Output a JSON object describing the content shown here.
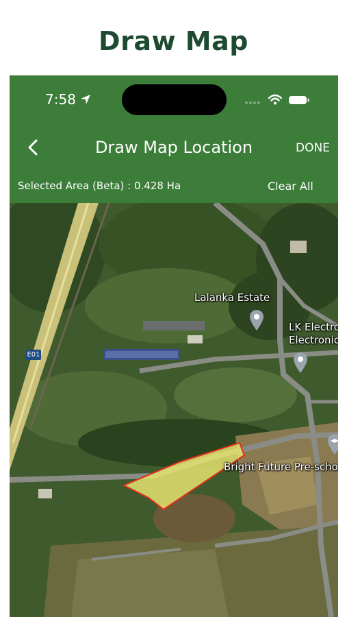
{
  "page": {
    "title": "Draw Map"
  },
  "status_bar": {
    "time": "7:58"
  },
  "navbar": {
    "title": "Draw Map Location",
    "done_label": "DONE",
    "back_icon": "chevron-left-icon"
  },
  "info_bar": {
    "area_text": "Selected Area (Beta) : 0.428 Ha",
    "clear_label": "Clear All"
  },
  "map": {
    "labels": {
      "lalanka": "Lalanka Estate",
      "lk_line1": "LK Electro",
      "lk_line2": "Electronic",
      "school": "Bright Future Pre-scho",
      "road": "E01"
    },
    "polygon_fill": "#e4e36f",
    "polygon_stroke": "#e22d1c"
  },
  "colors": {
    "header": "#3c7d3a",
    "title": "#1d4a30"
  }
}
